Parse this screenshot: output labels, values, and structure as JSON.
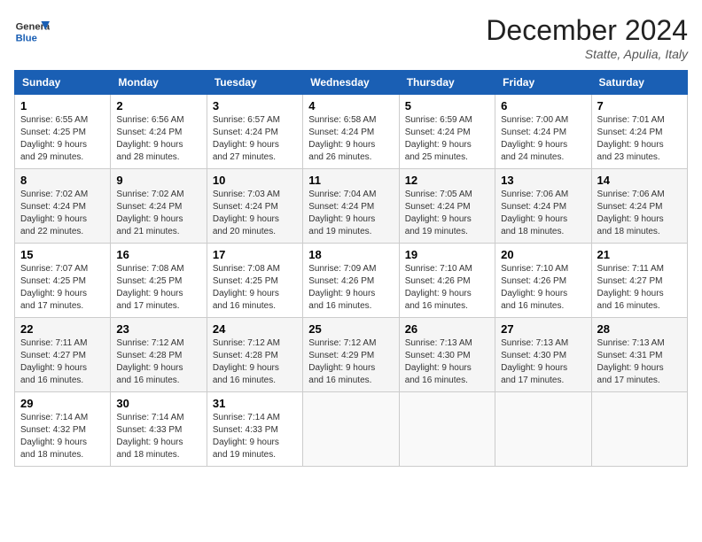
{
  "logo": {
    "general": "General",
    "blue": "Blue"
  },
  "title": "December 2024",
  "location": "Statte, Apulia, Italy",
  "days_header": [
    "Sunday",
    "Monday",
    "Tuesday",
    "Wednesday",
    "Thursday",
    "Friday",
    "Saturday"
  ],
  "weeks": [
    [
      {
        "day": "1",
        "info": "Sunrise: 6:55 AM\nSunset: 4:25 PM\nDaylight: 9 hours\nand 29 minutes."
      },
      {
        "day": "2",
        "info": "Sunrise: 6:56 AM\nSunset: 4:24 PM\nDaylight: 9 hours\nand 28 minutes."
      },
      {
        "day": "3",
        "info": "Sunrise: 6:57 AM\nSunset: 4:24 PM\nDaylight: 9 hours\nand 27 minutes."
      },
      {
        "day": "4",
        "info": "Sunrise: 6:58 AM\nSunset: 4:24 PM\nDaylight: 9 hours\nand 26 minutes."
      },
      {
        "day": "5",
        "info": "Sunrise: 6:59 AM\nSunset: 4:24 PM\nDaylight: 9 hours\nand 25 minutes."
      },
      {
        "day": "6",
        "info": "Sunrise: 7:00 AM\nSunset: 4:24 PM\nDaylight: 9 hours\nand 24 minutes."
      },
      {
        "day": "7",
        "info": "Sunrise: 7:01 AM\nSunset: 4:24 PM\nDaylight: 9 hours\nand 23 minutes."
      }
    ],
    [
      {
        "day": "8",
        "info": "Sunrise: 7:02 AM\nSunset: 4:24 PM\nDaylight: 9 hours\nand 22 minutes."
      },
      {
        "day": "9",
        "info": "Sunrise: 7:02 AM\nSunset: 4:24 PM\nDaylight: 9 hours\nand 21 minutes."
      },
      {
        "day": "10",
        "info": "Sunrise: 7:03 AM\nSunset: 4:24 PM\nDaylight: 9 hours\nand 20 minutes."
      },
      {
        "day": "11",
        "info": "Sunrise: 7:04 AM\nSunset: 4:24 PM\nDaylight: 9 hours\nand 19 minutes."
      },
      {
        "day": "12",
        "info": "Sunrise: 7:05 AM\nSunset: 4:24 PM\nDaylight: 9 hours\nand 19 minutes."
      },
      {
        "day": "13",
        "info": "Sunrise: 7:06 AM\nSunset: 4:24 PM\nDaylight: 9 hours\nand 18 minutes."
      },
      {
        "day": "14",
        "info": "Sunrise: 7:06 AM\nSunset: 4:24 PM\nDaylight: 9 hours\nand 18 minutes."
      }
    ],
    [
      {
        "day": "15",
        "info": "Sunrise: 7:07 AM\nSunset: 4:25 PM\nDaylight: 9 hours\nand 17 minutes."
      },
      {
        "day": "16",
        "info": "Sunrise: 7:08 AM\nSunset: 4:25 PM\nDaylight: 9 hours\nand 17 minutes."
      },
      {
        "day": "17",
        "info": "Sunrise: 7:08 AM\nSunset: 4:25 PM\nDaylight: 9 hours\nand 16 minutes."
      },
      {
        "day": "18",
        "info": "Sunrise: 7:09 AM\nSunset: 4:26 PM\nDaylight: 9 hours\nand 16 minutes."
      },
      {
        "day": "19",
        "info": "Sunrise: 7:10 AM\nSunset: 4:26 PM\nDaylight: 9 hours\nand 16 minutes."
      },
      {
        "day": "20",
        "info": "Sunrise: 7:10 AM\nSunset: 4:26 PM\nDaylight: 9 hours\nand 16 minutes."
      },
      {
        "day": "21",
        "info": "Sunrise: 7:11 AM\nSunset: 4:27 PM\nDaylight: 9 hours\nand 16 minutes."
      }
    ],
    [
      {
        "day": "22",
        "info": "Sunrise: 7:11 AM\nSunset: 4:27 PM\nDaylight: 9 hours\nand 16 minutes."
      },
      {
        "day": "23",
        "info": "Sunrise: 7:12 AM\nSunset: 4:28 PM\nDaylight: 9 hours\nand 16 minutes."
      },
      {
        "day": "24",
        "info": "Sunrise: 7:12 AM\nSunset: 4:28 PM\nDaylight: 9 hours\nand 16 minutes."
      },
      {
        "day": "25",
        "info": "Sunrise: 7:12 AM\nSunset: 4:29 PM\nDaylight: 9 hours\nand 16 minutes."
      },
      {
        "day": "26",
        "info": "Sunrise: 7:13 AM\nSunset: 4:30 PM\nDaylight: 9 hours\nand 16 minutes."
      },
      {
        "day": "27",
        "info": "Sunrise: 7:13 AM\nSunset: 4:30 PM\nDaylight: 9 hours\nand 17 minutes."
      },
      {
        "day": "28",
        "info": "Sunrise: 7:13 AM\nSunset: 4:31 PM\nDaylight: 9 hours\nand 17 minutes."
      }
    ],
    [
      {
        "day": "29",
        "info": "Sunrise: 7:14 AM\nSunset: 4:32 PM\nDaylight: 9 hours\nand 18 minutes."
      },
      {
        "day": "30",
        "info": "Sunrise: 7:14 AM\nSunset: 4:33 PM\nDaylight: 9 hours\nand 18 minutes."
      },
      {
        "day": "31",
        "info": "Sunrise: 7:14 AM\nSunset: 4:33 PM\nDaylight: 9 hours\nand 19 minutes."
      },
      null,
      null,
      null,
      null
    ]
  ]
}
